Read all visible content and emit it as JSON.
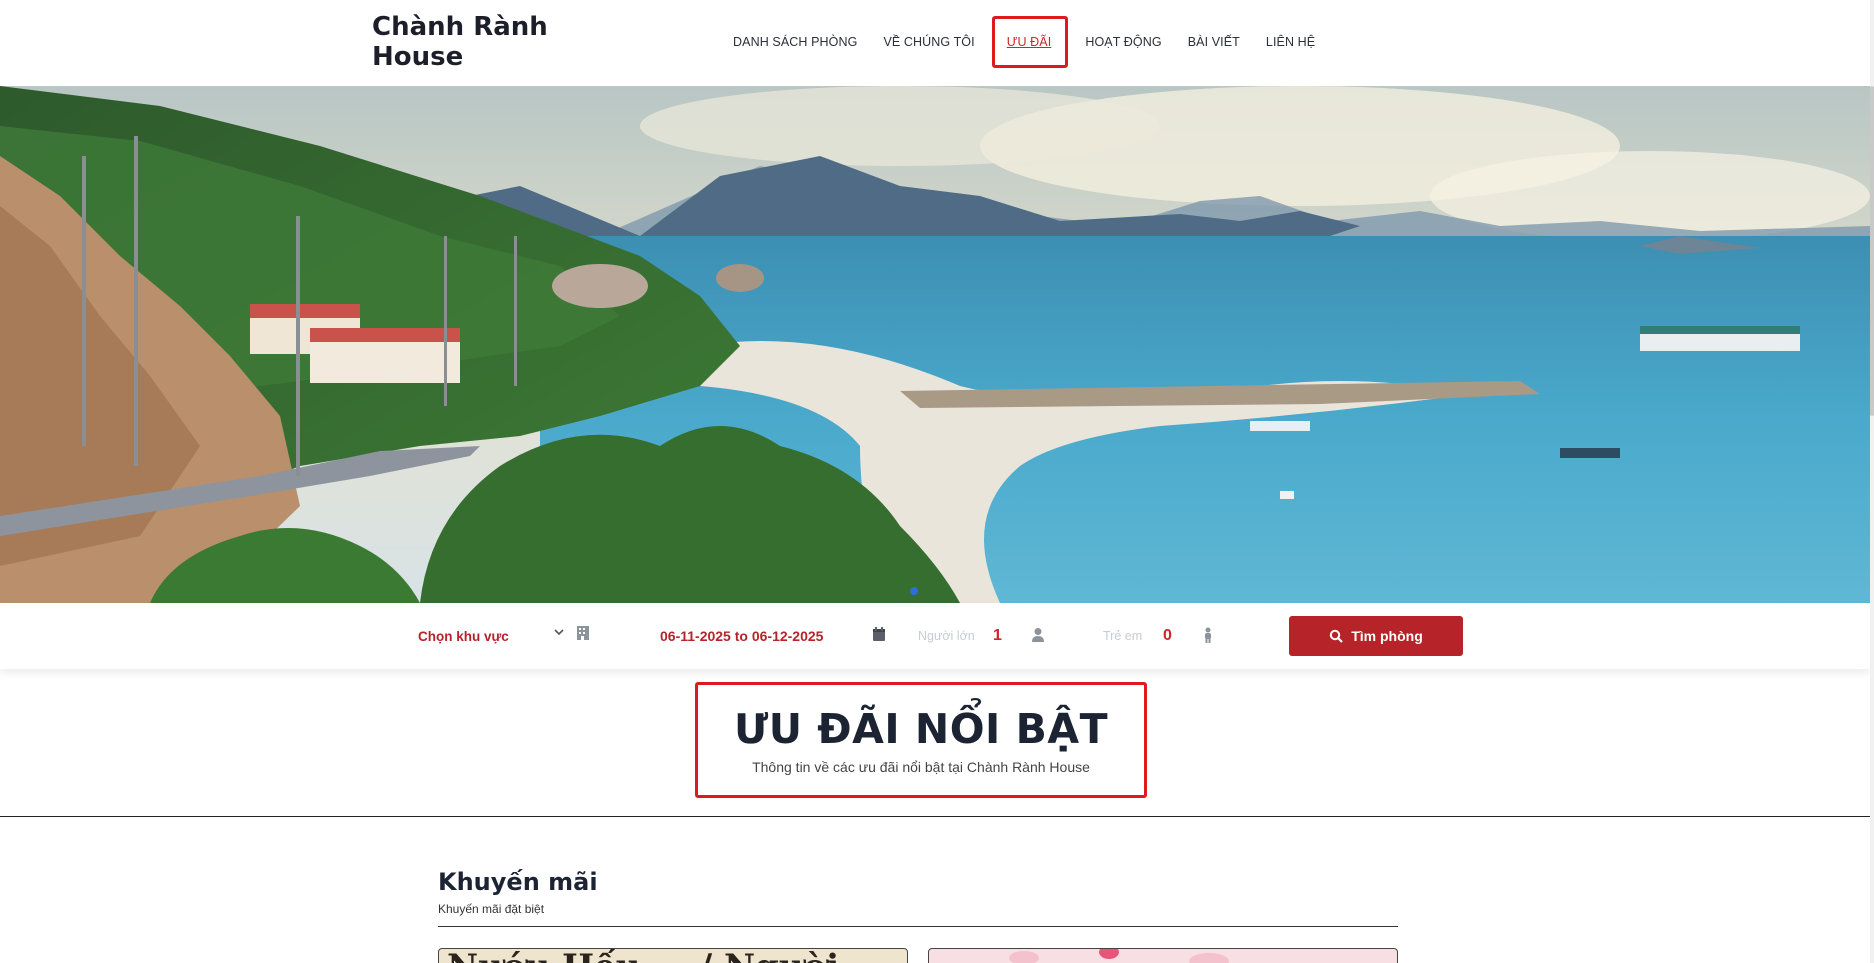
{
  "brand": {
    "name": "Chành Rành House"
  },
  "nav": {
    "items": [
      {
        "label": "DANH SÁCH PHÒNG"
      },
      {
        "label": "VỀ CHÚNG TÔI"
      },
      {
        "label": "ƯU ĐÃI"
      },
      {
        "label": "HOẠT ĐỘNG"
      },
      {
        "label": "BÀI VIẾT"
      },
      {
        "label": "LIÊN HỆ"
      }
    ],
    "active": "ƯU ĐÃI"
  },
  "hero": {
    "slide_count": 1,
    "active_slide": 1
  },
  "search": {
    "region_label": "Chọn khu vực",
    "date_range": "06-11-2025 to 06-12-2025",
    "adults_label": "Người lớn",
    "adults_value": "1",
    "children_label": "Trẻ em",
    "children_value": "0",
    "button_label": "Tìm phòng",
    "icons": [
      "chevron-down-icon",
      "building-icon",
      "calendar-icon",
      "user-icon",
      "child-icon",
      "search-icon"
    ]
  },
  "section": {
    "title": "ƯU ĐÃI NỔI BẬT",
    "subtitle": "Thông tin về các ưu đãi nổi bật tại Chành Rành House"
  },
  "promotions": {
    "title": "Khuyến mãi",
    "subtitle": "Khuyến mãi đặt biệt",
    "card1_text": "Nướu Hếu ... / Người",
    "accent_color": "#b62328"
  }
}
